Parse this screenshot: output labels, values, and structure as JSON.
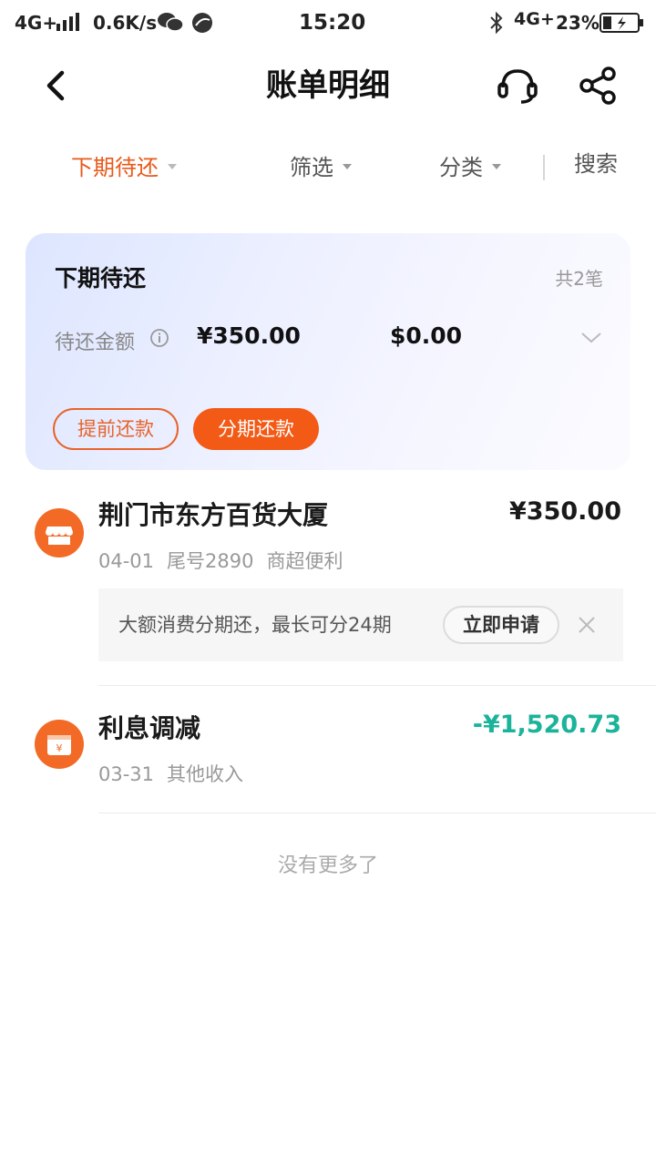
{
  "status_bar": {
    "network": "4G+",
    "speed": "0.6K/s",
    "time": "15:20",
    "network_right": "4G+",
    "battery": "23%"
  },
  "header": {
    "title": "账单明细",
    "back_icon": "chevron-left-icon",
    "service_icon": "headset-icon",
    "share_icon": "share-icon"
  },
  "tabs": [
    {
      "label": "下期待还",
      "active": true,
      "has_caret": true
    },
    {
      "label": "筛选",
      "active": false,
      "has_caret": true
    },
    {
      "label": "分类",
      "active": false,
      "has_caret": true
    },
    {
      "label": "搜索",
      "active": false,
      "has_caret": false
    }
  ],
  "summary": {
    "title": "下期待还",
    "count": "共2笔",
    "amount_label": "待还金额",
    "amount_primary": "¥350.00",
    "amount_secondary": "$0.00",
    "btn_prepay": "提前还款",
    "btn_installment": "分期还款"
  },
  "transactions": [
    {
      "icon": "store-icon",
      "title": "荆门市东方百货大厦",
      "amount": "¥350.00",
      "date": "04-01",
      "card": "尾号2890",
      "category": "商超便利"
    },
    {
      "icon": "wallet-yuan-icon",
      "title": "利息调减",
      "amount": "-¥1,520.73",
      "date": "03-31",
      "category": "其他收入"
    }
  ],
  "promo": {
    "text": "大额消费分期还，最长可分24期",
    "button": "立即申请"
  },
  "end_note": "没有更多了",
  "colors": {
    "accent": "#f25a16",
    "active_tab": "#e85a1c",
    "positive": "#1bb39a"
  }
}
